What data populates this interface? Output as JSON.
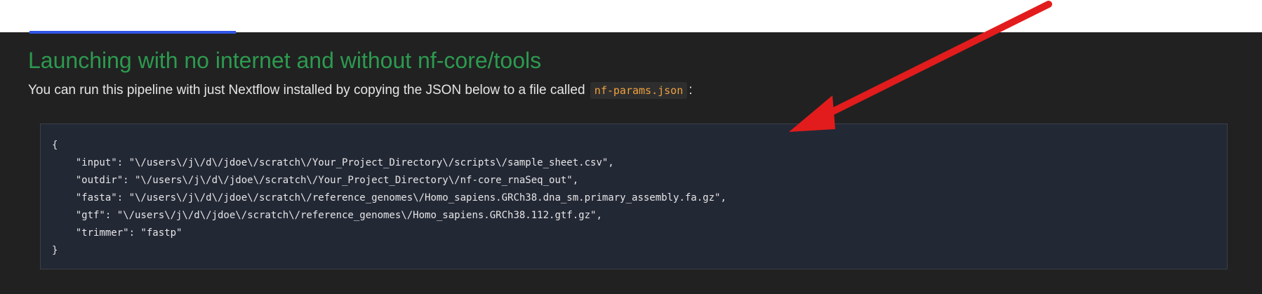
{
  "heading": "Launching with no internet and without nf-core/tools",
  "intro": {
    "text_before": "You can run this pipeline with just Nextflow installed by copying the JSON below to a file called ",
    "filename": "nf-params.json",
    "text_after": ":"
  },
  "code": {
    "lines": [
      "{",
      "    \"input\": \"\\/users\\/j\\/d\\/jdoe\\/scratch\\/Your_Project_Directory\\/scripts\\/sample_sheet.csv\",",
      "    \"outdir\": \"\\/users\\/j\\/d\\/jdoe\\/scratch\\/Your_Project_Directory\\/nf-core_rnaSeq_out\",",
      "    \"fasta\": \"\\/users\\/j\\/d\\/jdoe\\/scratch\\/reference_genomes\\/Homo_sapiens.GRCh38.dna_sm.primary_assembly.fa.gz\",",
      "    \"gtf\": \"\\/users\\/j\\/d\\/jdoe\\/scratch\\/reference_genomes\\/Homo_sapiens.GRCh38.112.gtf.gz\",",
      "    \"trimmer\": \"fastp\"",
      "}"
    ]
  },
  "colors": {
    "heading": "#2c9a4f",
    "background": "#212121",
    "code_background": "#232835",
    "arrow": "#e21c1c",
    "filename_code": "#f0a040"
  },
  "annotation_icon": "red-arrow-icon"
}
